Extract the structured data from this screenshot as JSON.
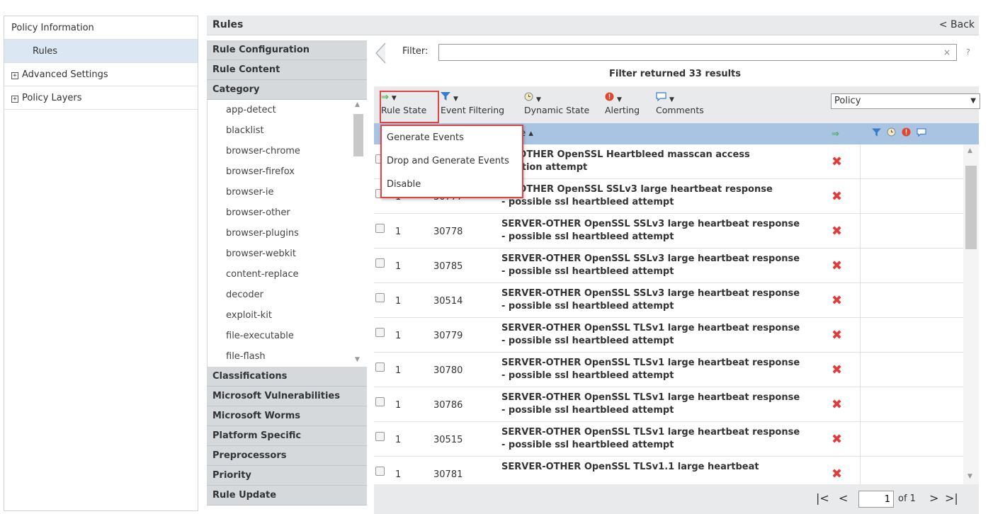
{
  "left_nav": {
    "policy_information": "Policy Information",
    "rules": "Rules",
    "advanced_settings": "Advanced Settings",
    "policy_layers": "Policy Layers"
  },
  "header": {
    "title": "Rules",
    "back": "< Back"
  },
  "accordion": {
    "rule_configuration": "Rule Configuration",
    "rule_content": "Rule Content",
    "category": "Category",
    "categories": [
      "app-detect",
      "blacklist",
      "browser-chrome",
      "browser-firefox",
      "browser-ie",
      "browser-other",
      "browser-plugins",
      "browser-webkit",
      "content-replace",
      "decoder",
      "exploit-kit",
      "file-executable",
      "file-flash"
    ],
    "after": [
      "Classifications",
      "Microsoft Vulnerabilities",
      "Microsoft Worms",
      "Platform Specific",
      "Preprocessors",
      "Priority",
      "Rule Update"
    ]
  },
  "filter": {
    "label": "Filter:",
    "value": "",
    "clear": "×",
    "help": "?",
    "result": "Filter returned 33 results"
  },
  "toolbar": {
    "rule_state": "Rule State",
    "event_filtering": "Event Filtering",
    "dynamic_state": "Dynamic State",
    "alerting": "Alerting",
    "comments": "Comments",
    "policy_select": "Policy"
  },
  "table": {
    "message_header": "age ▴"
  },
  "rule_state_menu": [
    "Generate Events",
    "Drop and Generate Events",
    "Disable"
  ],
  "rows": [
    {
      "gid": "",
      "sid": "",
      "line1": "ER-OTHER OpenSSL Heartbleed masscan access",
      "line2": "bitation attempt"
    },
    {
      "gid": "1",
      "sid": "30777",
      "line1": "ER-OTHER OpenSSL SSLv3 large heartbeat response",
      "line2": "- possible ssl heartbleed attempt"
    },
    {
      "gid": "1",
      "sid": "30778",
      "line1": "SERVER-OTHER OpenSSL SSLv3 large heartbeat response",
      "line2": "- possible ssl heartbleed attempt"
    },
    {
      "gid": "1",
      "sid": "30785",
      "line1": "SERVER-OTHER OpenSSL SSLv3 large heartbeat response",
      "line2": "- possible ssl heartbleed attempt"
    },
    {
      "gid": "1",
      "sid": "30514",
      "line1": "SERVER-OTHER OpenSSL SSLv3 large heartbeat response",
      "line2": "- possible ssl heartbleed attempt"
    },
    {
      "gid": "1",
      "sid": "30779",
      "line1": "SERVER-OTHER OpenSSL TLSv1 large heartbeat response",
      "line2": "- possible ssl heartbleed attempt"
    },
    {
      "gid": "1",
      "sid": "30780",
      "line1": "SERVER-OTHER OpenSSL TLSv1 large heartbeat response",
      "line2": "- possible ssl heartbleed attempt"
    },
    {
      "gid": "1",
      "sid": "30786",
      "line1": "SERVER-OTHER OpenSSL TLSv1 large heartbeat response",
      "line2": "- possible ssl heartbleed attempt"
    },
    {
      "gid": "1",
      "sid": "30515",
      "line1": "SERVER-OTHER OpenSSL TLSv1 large heartbeat response",
      "line2": "- possible ssl heartbleed attempt"
    },
    {
      "gid": "1",
      "sid": "30781",
      "line1": "SERVER-OTHER OpenSSL TLSv1.1 large heartbeat",
      "line2": ""
    }
  ],
  "pager": {
    "page": "1",
    "of": "of 1"
  },
  "icons": {
    "rule_state": "green-arrow-icon",
    "event_filtering": "funnel-icon",
    "dynamic_state": "clock-icon",
    "alerting": "alert-icon",
    "comments": "comment-icon",
    "row_state": "red-x-icon"
  },
  "colors": {
    "header_blue": "#a9c4e2",
    "highlight_red": "#e04545",
    "disabled_x": "#e03c3c"
  }
}
